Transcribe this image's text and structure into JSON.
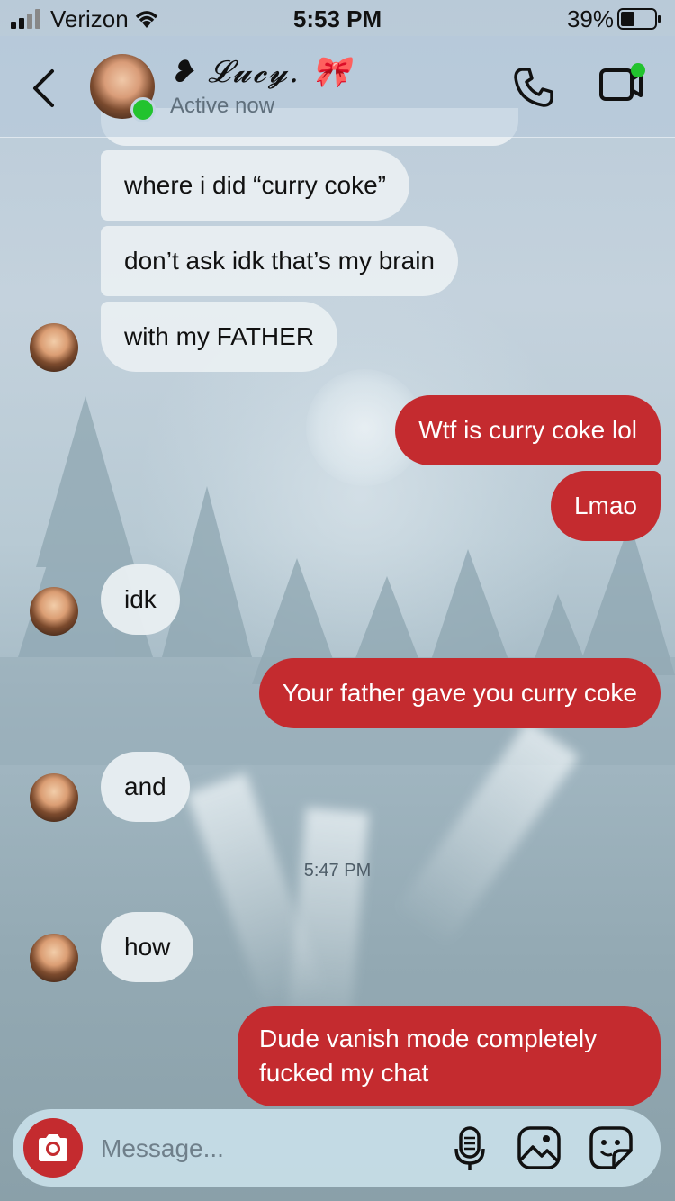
{
  "status_bar": {
    "carrier": "Verizon",
    "time": "5:53 PM",
    "battery": "39%"
  },
  "header": {
    "contact_name": "❥ 𝓛𝓾𝓬𝔂. 🎀",
    "contact_status": "Active now",
    "online_color": "#22c32e"
  },
  "messages": [
    {
      "direction": "incoming",
      "text": "where i did “curry coke”"
    },
    {
      "direction": "incoming",
      "text": "don’t ask idk that’s my brain"
    },
    {
      "direction": "incoming",
      "text": "with my FATHER"
    },
    {
      "direction": "outgoing",
      "text": "Wtf is curry coke lol"
    },
    {
      "direction": "outgoing",
      "text": "Lmao"
    },
    {
      "direction": "incoming",
      "text": "idk"
    },
    {
      "direction": "outgoing",
      "text": "Your father gave you curry coke"
    },
    {
      "direction": "incoming",
      "text": "and"
    },
    {
      "direction": "incoming",
      "text": "how"
    },
    {
      "direction": "outgoing",
      "text": "Dude vanish mode completely fucked my chat"
    }
  ],
  "timestamp_divider": "5:47 PM",
  "composer": {
    "placeholder": "Message..."
  },
  "icons": {
    "back": "chevron-left-icon",
    "call": "phone-icon",
    "video": "video-call-icon",
    "camera": "camera-icon",
    "mic": "microphone-icon",
    "gallery": "image-icon",
    "sticker": "sticker-icon"
  },
  "colors": {
    "outgoing_bubble": "#c42b2f",
    "incoming_bubble": "#e8eef1",
    "accent_green": "#22c32e"
  }
}
